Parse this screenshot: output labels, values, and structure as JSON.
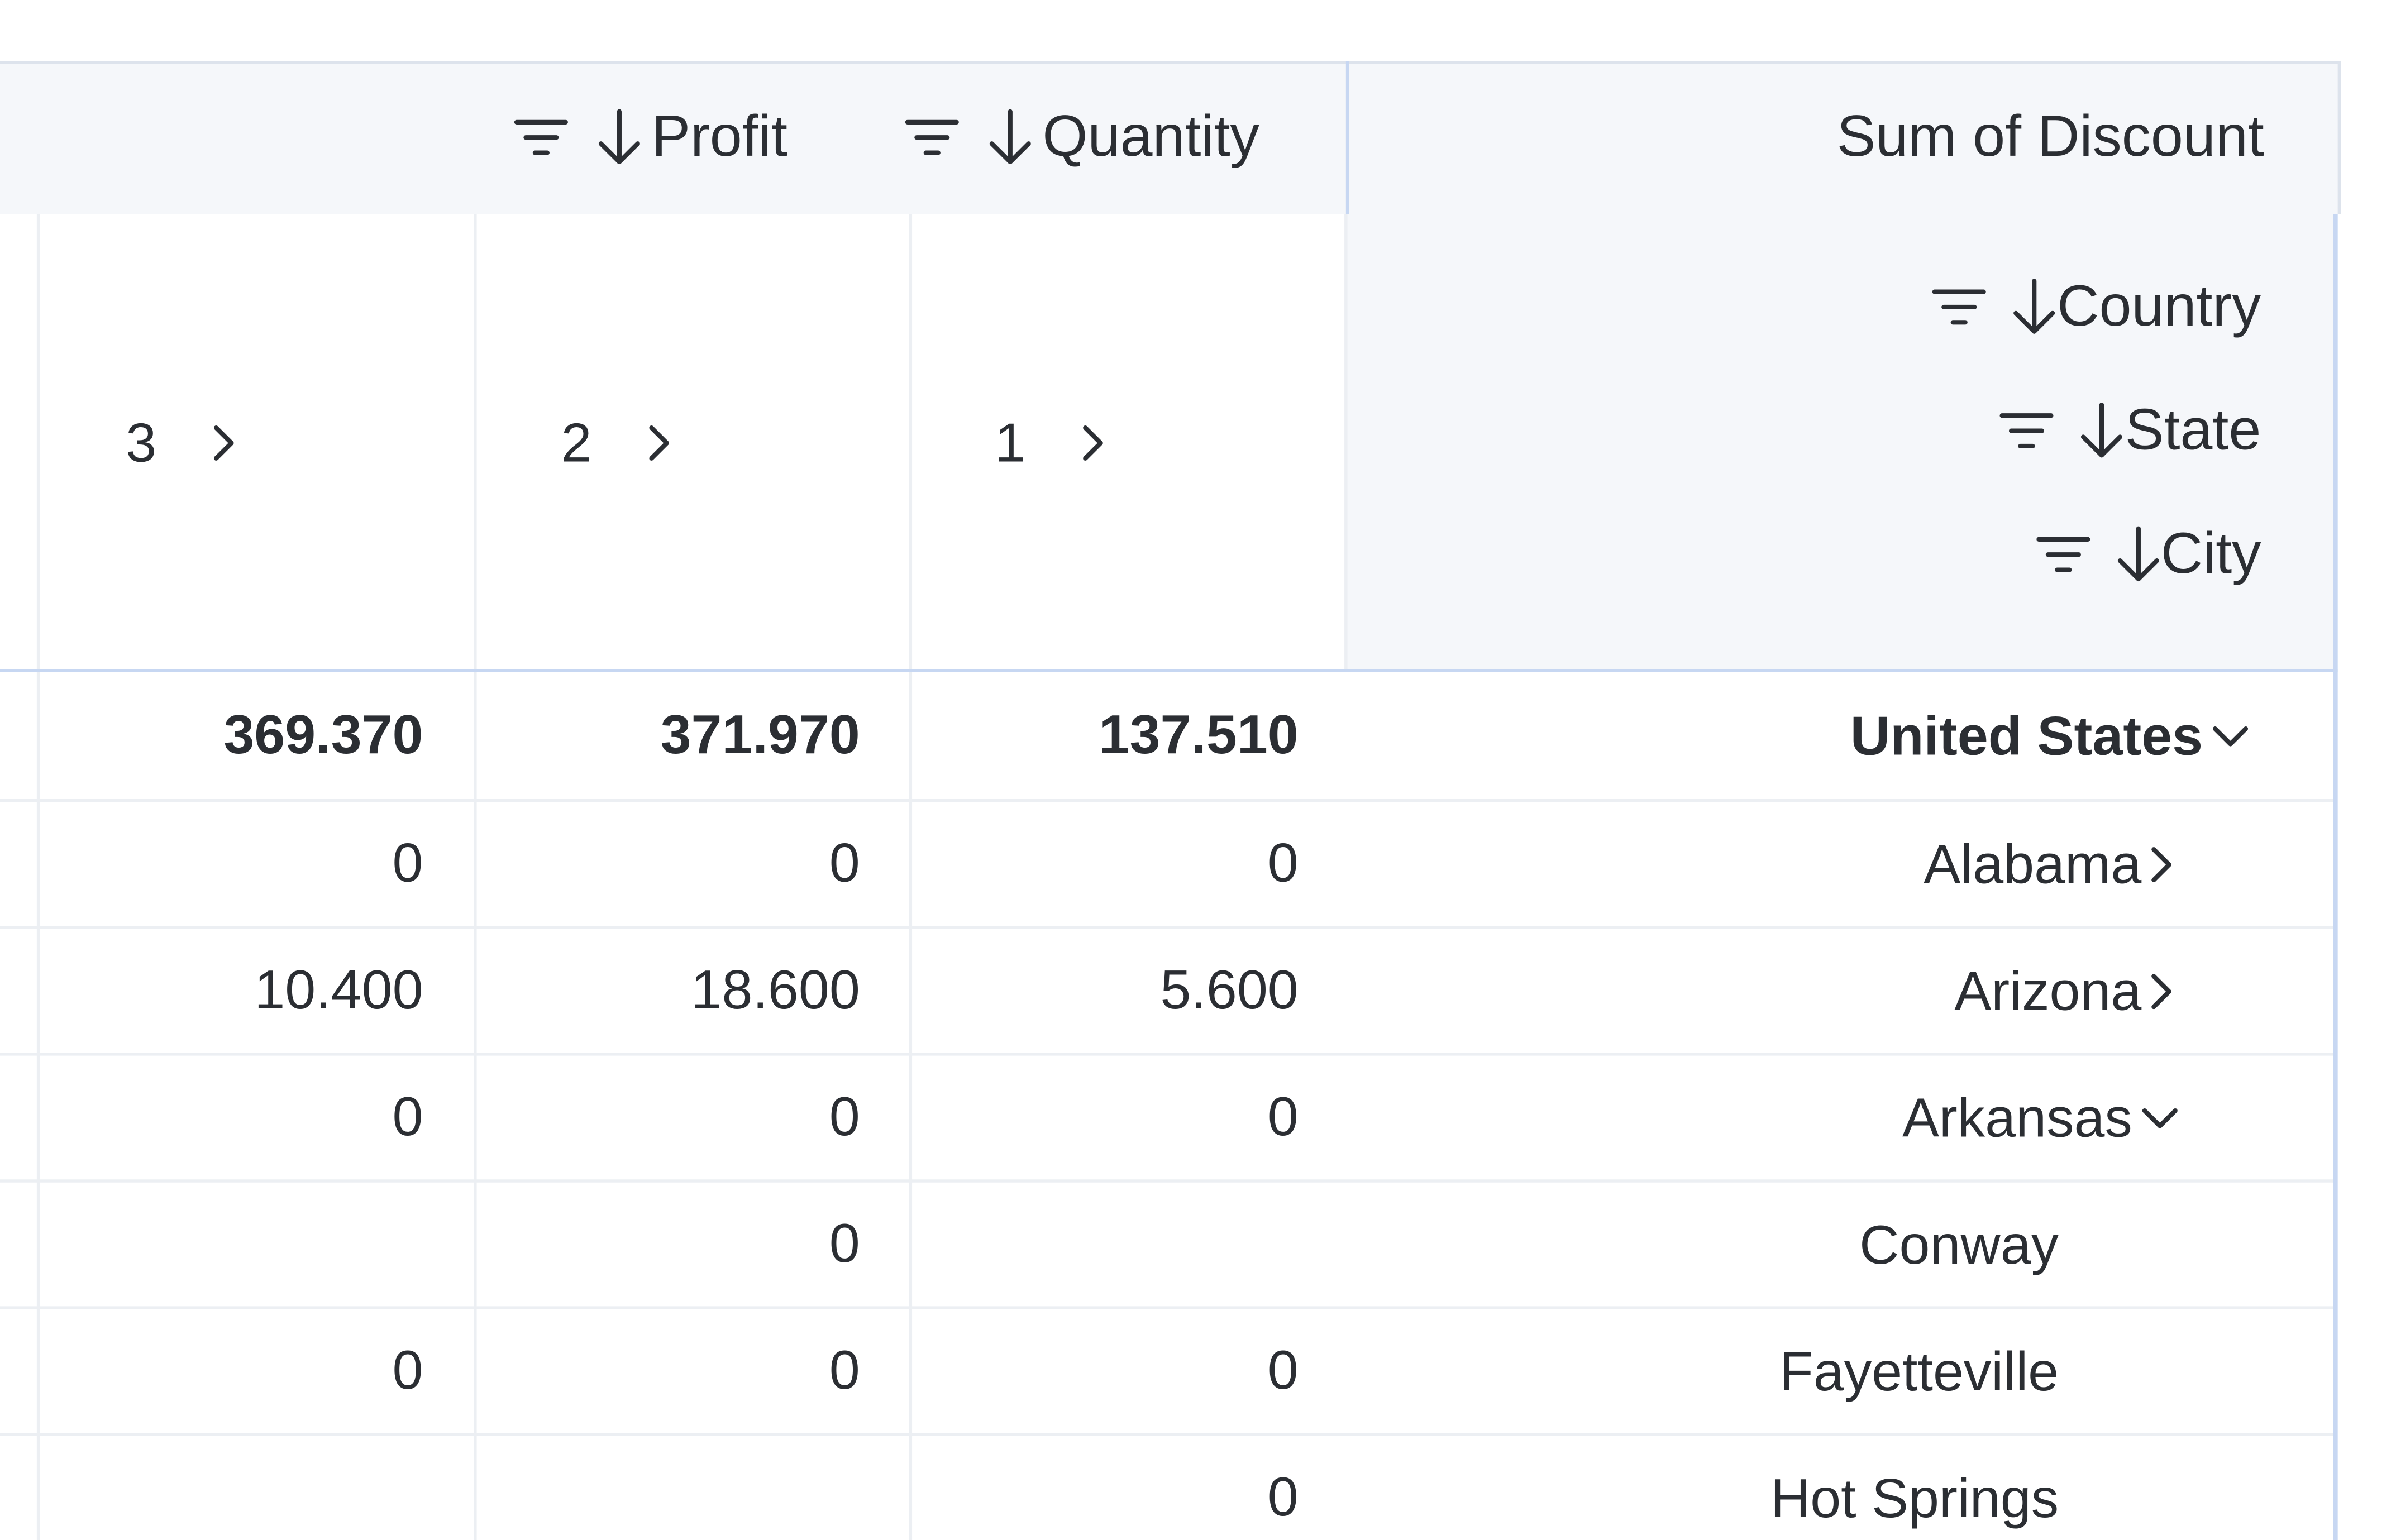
{
  "header": {
    "profit_label": "Profit",
    "quantity_label": "Quantity",
    "sum_label": "Sum of Discount"
  },
  "dimensions": {
    "country": "Country",
    "state": "State",
    "city": "City"
  },
  "columns": [
    {
      "label": "3"
    },
    {
      "label": "2"
    },
    {
      "label": "1"
    }
  ],
  "rows": [
    {
      "label": "United States",
      "expand": "down",
      "bold": true,
      "values": [
        "369.370",
        "371.970",
        "137.510"
      ]
    },
    {
      "label": "Alabama",
      "expand": "right",
      "bold": false,
      "values": [
        "0",
        "0",
        "0"
      ]
    },
    {
      "label": "Arizona",
      "expand": "right",
      "bold": false,
      "values": [
        "10.400",
        "18.600",
        "5.600"
      ]
    },
    {
      "label": "Arkansas",
      "expand": "down",
      "bold": false,
      "values": [
        "0",
        "0",
        "0"
      ]
    },
    {
      "label": "Conway",
      "expand": "none",
      "bold": false,
      "values": [
        "",
        "0",
        ""
      ]
    },
    {
      "label": "Fayetteville",
      "expand": "none",
      "bold": false,
      "values": [
        "0",
        "0",
        "0"
      ]
    },
    {
      "label": "Hot Springs",
      "expand": "none",
      "bold": false,
      "values": [
        "",
        "",
        "0"
      ]
    }
  ]
}
